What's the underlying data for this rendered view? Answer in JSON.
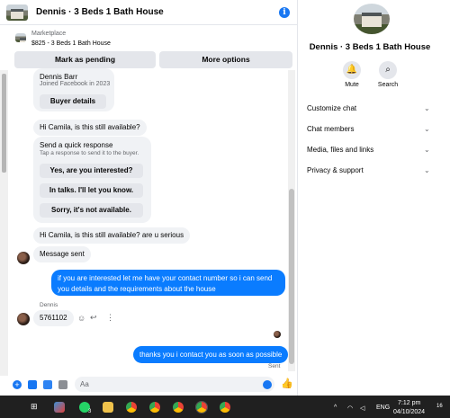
{
  "header": {
    "title": "Dennis · 3 Beds 1 Bath House"
  },
  "marketplace": {
    "label": "Marketplace",
    "listing": "$825 - 3 Beds 1 Bath House"
  },
  "actions": {
    "pending": "Mark as pending",
    "more": "More options"
  },
  "seller": {
    "name": "Dennis Barr",
    "joined": "Joined Facebook in 2023",
    "details_btn": "Buyer details"
  },
  "messages": {
    "m1": "Hi Camila, is this still available?",
    "quick_title": "Send a quick response",
    "quick_sub": "Tap a response to send it to the buyer.",
    "q1": "Yes, are you interested?",
    "q2": "In talks. I'll let you know.",
    "q3": "Sorry, it's not available.",
    "m2": "Hi Camila, is this still available? are u serious",
    "m3": "Message sent",
    "m4a": "if you are interested let me have your contact number so i can send",
    "m4b": "you details and the requirements about the house",
    "sender": "Dennis",
    "m5": "5761102",
    "m6": "thanks you i contact you as soon as possible",
    "status": "Sent"
  },
  "composer": {
    "placeholder": "Aa"
  },
  "right": {
    "name": "Dennis · 3 Beds 1 Bath House",
    "mute": "Mute",
    "search": "Search",
    "rows": [
      "Customize chat",
      "Chat members",
      "Media, files and links",
      "Privacy & support"
    ]
  },
  "taskbar": {
    "lang": "ENG",
    "time": "7:12 pm",
    "date": "04/10/2024",
    "badge": "3",
    "notif": "16"
  }
}
